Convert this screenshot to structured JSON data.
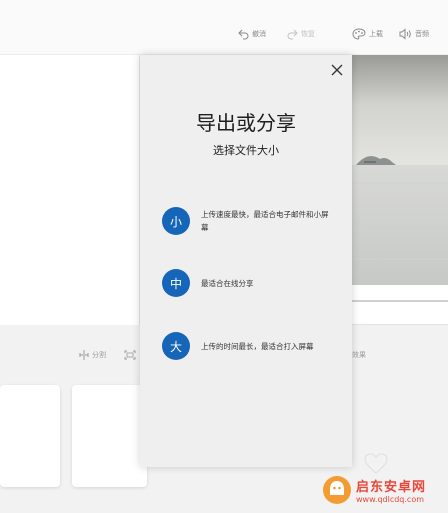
{
  "toolbar": {
    "undo_label": "撤消",
    "redo_label": "恢复",
    "upload_label": "上载",
    "audio_label": "音频"
  },
  "bottom_tools": {
    "split_label": "分割",
    "resize_label": "",
    "effects_label": "效果"
  },
  "export_panel": {
    "title": "导出或分享",
    "subtitle": "选择文件大小",
    "options": [
      {
        "badge": "小",
        "text": "上传速度最快，最适合电子邮件和小屏幕"
      },
      {
        "badge": "中",
        "text": "最适合在线分享"
      },
      {
        "badge": "大",
        "text": "上传的时间最长，最适合打入屏幕"
      }
    ]
  },
  "watermark": {
    "name": "启东安卓网",
    "url": "www.qdlcdq.com"
  },
  "colors": {
    "accent": "#1565b8",
    "watermark": "#e8483b"
  }
}
